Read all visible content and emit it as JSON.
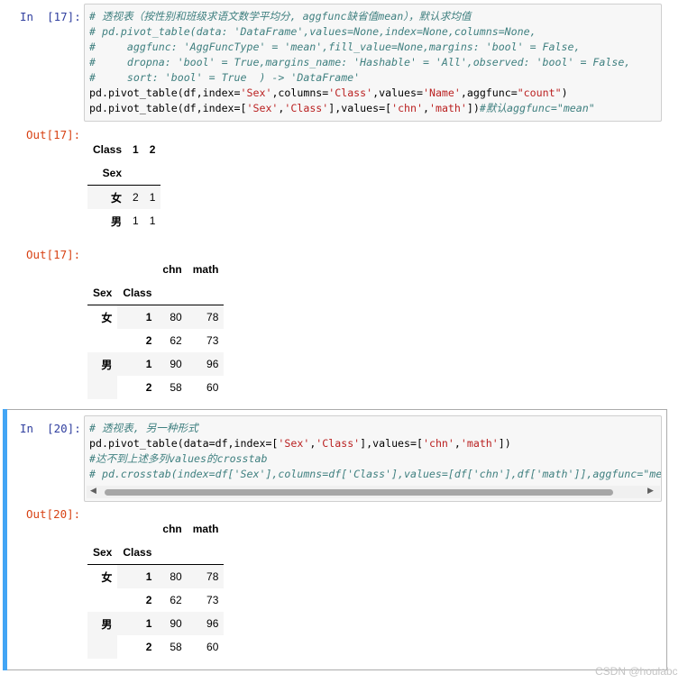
{
  "cells": [
    {
      "in_prompt": "In  [17]:",
      "code_lines": [
        [
          {
            "t": "cm",
            "v": "# 透视表（按性别和班级求语文数学平均分, aggfunc缺省值mean），默认求均值"
          }
        ],
        [
          {
            "t": "cm",
            "v": "# pd.pivot_table(data: 'DataFrame',values=None,index=None,columns=None,"
          }
        ],
        [
          {
            "t": "cm",
            "v": "#     aggfunc: 'AggFuncType' = 'mean',fill_value=None,margins: 'bool' = False,"
          }
        ],
        [
          {
            "t": "cm",
            "v": "#     dropna: 'bool' = True,margins_name: 'Hashable' = 'All',observed: 'bool' = False,"
          }
        ],
        [
          {
            "t": "cm",
            "v": "#     sort: 'bool' = True  ) -> 'DataFrame'"
          }
        ],
        [
          {
            "t": "p",
            "v": "pd.pivot_table(df,index="
          },
          {
            "t": "st",
            "v": "'Sex'"
          },
          {
            "t": "p",
            "v": ",columns="
          },
          {
            "t": "st",
            "v": "'Class'"
          },
          {
            "t": "p",
            "v": ",values="
          },
          {
            "t": "st",
            "v": "'Name'"
          },
          {
            "t": "p",
            "v": ",aggfunc="
          },
          {
            "t": "st",
            "v": "\"count\""
          },
          {
            "t": "p",
            "v": ")"
          }
        ],
        [
          {
            "t": "p",
            "v": "pd.pivot_table(df,index=["
          },
          {
            "t": "st",
            "v": "'Sex'"
          },
          {
            "t": "p",
            "v": ","
          },
          {
            "t": "st",
            "v": "'Class'"
          },
          {
            "t": "p",
            "v": "],values=["
          },
          {
            "t": "st",
            "v": "'chn'"
          },
          {
            "t": "p",
            "v": ","
          },
          {
            "t": "st",
            "v": "'math'"
          },
          {
            "t": "p",
            "v": "])"
          },
          {
            "t": "cm",
            "v": "#默认aggfunc=\"mean\""
          }
        ]
      ],
      "outputs": [
        {
          "out_prompt": "Out[17]:",
          "table1": {
            "columns_name": "Class",
            "columns": [
              "1",
              "2"
            ],
            "index_name": "Sex",
            "rows": [
              {
                "label": "女",
                "values": [
                  "2",
                  "1"
                ]
              },
              {
                "label": "男",
                "values": [
                  "1",
                  "1"
                ]
              }
            ]
          }
        },
        {
          "out_prompt": "Out[17]:",
          "table2": {
            "columns": [
              "chn",
              "math"
            ],
            "index_names": [
              "Sex",
              "Class"
            ],
            "rows": [
              {
                "sex": "女",
                "class": "1",
                "values": [
                  "80",
                  "78"
                ]
              },
              {
                "sex": "",
                "class": "2",
                "values": [
                  "62",
                  "73"
                ]
              },
              {
                "sex": "男",
                "class": "1",
                "values": [
                  "90",
                  "96"
                ]
              },
              {
                "sex": "",
                "class": "2",
                "values": [
                  "58",
                  "60"
                ]
              }
            ]
          }
        }
      ]
    },
    {
      "in_prompt": "In  [20]:",
      "code_lines": [
        [
          {
            "t": "cm",
            "v": "# 透视表, 另一种形式"
          }
        ],
        [
          {
            "t": "p",
            "v": "pd.pivot_table(data=df,index=["
          },
          {
            "t": "st",
            "v": "'Sex'"
          },
          {
            "t": "p",
            "v": ","
          },
          {
            "t": "st",
            "v": "'Class'"
          },
          {
            "t": "p",
            "v": "],values=["
          },
          {
            "t": "st",
            "v": "'chn'"
          },
          {
            "t": "p",
            "v": ","
          },
          {
            "t": "st",
            "v": "'math'"
          },
          {
            "t": "p",
            "v": "])"
          }
        ],
        [
          {
            "t": "cm",
            "v": "#达不到上述多列values的crosstab"
          }
        ],
        [
          {
            "t": "cm",
            "v": "# pd.crosstab(index=df['Sex'],columns=df['Class'],values=[df['chn'],df['math']],aggfunc=\"me"
          }
        ]
      ],
      "outputs": [
        {
          "out_prompt": "Out[20]:",
          "table2": {
            "columns": [
              "chn",
              "math"
            ],
            "index_names": [
              "Sex",
              "Class"
            ],
            "rows": [
              {
                "sex": "女",
                "class": "1",
                "values": [
                  "80",
                  "78"
                ]
              },
              {
                "sex": "",
                "class": "2",
                "values": [
                  "62",
                  "73"
                ]
              },
              {
                "sex": "男",
                "class": "1",
                "values": [
                  "90",
                  "96"
                ]
              },
              {
                "sex": "",
                "class": "2",
                "values": [
                  "58",
                  "60"
                ]
              }
            ]
          }
        }
      ]
    }
  ],
  "scrollbar": {
    "left_arrow": "◀",
    "right_arrow": "▶"
  },
  "watermark": "CSDN @houlabc",
  "colors": {
    "in_prompt": "#303f9f",
    "out_prompt": "#d84315",
    "comment": "#408080",
    "string": "#ba2121",
    "selected": "#42a5f5"
  }
}
